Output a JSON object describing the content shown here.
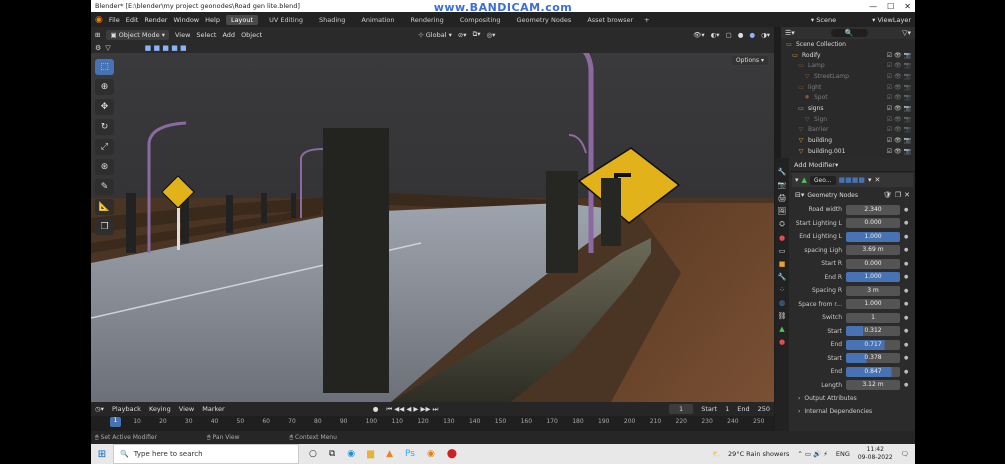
{
  "watermark": "www.BANDICAM.com",
  "window": {
    "title": "Blender* [E:\\blender\\my project geonodes\\Road gen lite.blend]"
  },
  "menu": [
    "File",
    "Edit",
    "Render",
    "Window",
    "Help"
  ],
  "workspaces": [
    "Layout",
    "UV Editing",
    "Shading",
    "Animation",
    "Rendering",
    "Compositing",
    "Geometry Nodes",
    "Asset browser"
  ],
  "scene_label": "Scene",
  "viewlayer_label": "ViewLayer",
  "viewport": {
    "mode": "Object Mode",
    "menus": [
      "View",
      "Select",
      "Add",
      "Object"
    ],
    "transform": "Global",
    "options": "Options"
  },
  "timeline": {
    "menus": [
      "Playback",
      "Keying",
      "View",
      "Marker"
    ],
    "current_frame": "1",
    "start_label": "Start",
    "start": "1",
    "end_label": "End",
    "end": "250",
    "ticks": [
      "1",
      "10",
      "20",
      "30",
      "40",
      "50",
      "60",
      "70",
      "80",
      "90",
      "100",
      "110",
      "120",
      "130",
      "140",
      "150",
      "160",
      "170",
      "180",
      "190",
      "200",
      "210",
      "220",
      "230",
      "240",
      "250"
    ]
  },
  "statusbar": [
    "Set Active Modifier",
    "Pan View",
    "Context Menu"
  ],
  "outliner": {
    "items": [
      {
        "label": "Scene Collection",
        "icon": "collection-icon",
        "dim": false
      },
      {
        "label": "Rodify",
        "icon": "collection-icon",
        "dim": false
      },
      {
        "label": "Lamp",
        "icon": "collection-icon",
        "dim": true
      },
      {
        "label": "StreetLamp",
        "icon": "mesh-icon",
        "dim": true
      },
      {
        "label": "light",
        "icon": "collection-icon",
        "dim": true
      },
      {
        "label": "Spot",
        "icon": "light-icon",
        "dim": true
      },
      {
        "label": "signs",
        "icon": "collection-icon",
        "dim": false
      },
      {
        "label": "Sign",
        "icon": "mesh-icon",
        "dim": true
      },
      {
        "label": "Barrier",
        "icon": "mesh-icon",
        "dim": true
      },
      {
        "label": "building",
        "icon": "mesh-icon",
        "dim": false
      },
      {
        "label": "building.001",
        "icon": "mesh-icon",
        "dim": false
      }
    ]
  },
  "properties": {
    "add_modifier": "Add Modifier",
    "modifier_name": "Geo...",
    "node_group": "Geometry Nodes",
    "fields": [
      {
        "label": "Road width",
        "value": "2.340",
        "blue": false,
        "fill": 0
      },
      {
        "label": "Start Lighting L",
        "value": "0.000",
        "blue": false,
        "fill": 0
      },
      {
        "label": "End Lighting L",
        "value": "1.000",
        "blue": true,
        "fill": 1.0
      },
      {
        "label": "spacing Ligh",
        "value": "3.69 m",
        "blue": false,
        "fill": 0
      },
      {
        "label": "Start R",
        "value": "0.000",
        "blue": false,
        "fill": 0
      },
      {
        "label": "End R",
        "value": "1.000",
        "blue": true,
        "fill": 1.0
      },
      {
        "label": "Spacing R",
        "value": "3 m",
        "blue": false,
        "fill": 0
      },
      {
        "label": "Space from r...",
        "value": "1.000",
        "blue": false,
        "fill": 0
      },
      {
        "label": "Switch",
        "value": "1",
        "blue": false,
        "fill": 0
      },
      {
        "label": "Start",
        "value": "0.312",
        "blue": true,
        "fill": 0.312
      },
      {
        "label": "End",
        "value": "0.717",
        "blue": true,
        "fill": 0.717
      },
      {
        "label": "Start",
        "value": "0.378",
        "blue": true,
        "fill": 0.378
      },
      {
        "label": "End",
        "value": "0.847",
        "blue": true,
        "fill": 0.847
      },
      {
        "label": "Length",
        "value": "3.12 m",
        "blue": false,
        "fill": 0
      }
    ],
    "subpanels": [
      "Output Attributes",
      "Internal Dependencies"
    ]
  },
  "taskbar": {
    "search_placeholder": "Type here to search",
    "weather": "29°C  Rain showers",
    "language": "ENG",
    "time": "11:42",
    "date": "09-08-2022"
  }
}
